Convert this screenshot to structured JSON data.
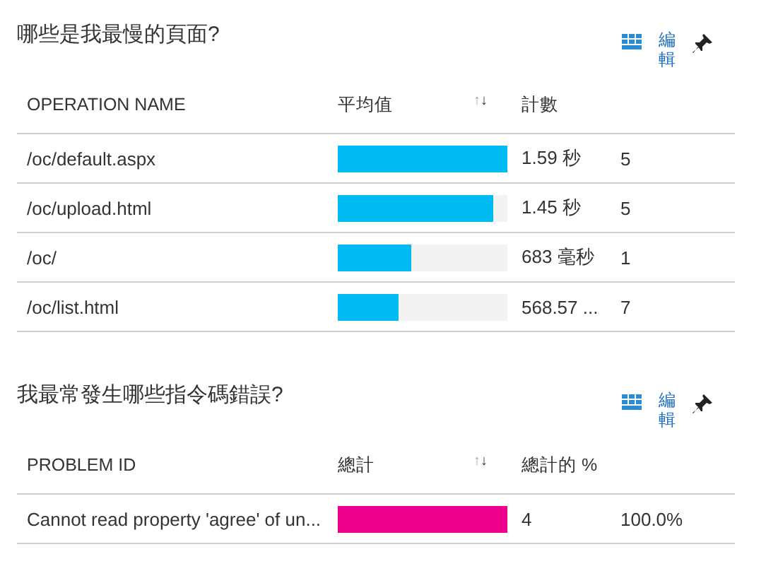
{
  "sections": [
    {
      "title": "哪些是我最慢的頁面?",
      "edit": "編輯",
      "columns": [
        "OPERATION NAME",
        "平均值",
        "計數"
      ],
      "sort": "↑↓",
      "color": "#00bcf2",
      "rows": [
        {
          "name": "/oc/default.aspx",
          "level": 1.0,
          "reading": "1.59 秒",
          "extra": "5"
        },
        {
          "name": "/oc/upload.html",
          "level": 0.92,
          "reading": "1.45 秒",
          "extra": "5"
        },
        {
          "name": "/oc/",
          "level": 0.43,
          "reading": "683 毫秒",
          "extra": "1"
        },
        {
          "name": "/oc/list.html",
          "level": 0.36,
          "reading": "568.57 ...",
          "extra": "7"
        }
      ]
    },
    {
      "title": "我最常發生哪些指令碼錯誤?",
      "edit": "編輯",
      "columns": [
        "PROBLEM ID",
        "總計",
        "總計的 %"
      ],
      "sort": "↑↓",
      "color": "#ec008c",
      "rows": [
        {
          "name": "Cannot read property 'agree' of un...",
          "level": 1.0,
          "reading": "4",
          "extra": "100.0%"
        }
      ]
    }
  ]
}
